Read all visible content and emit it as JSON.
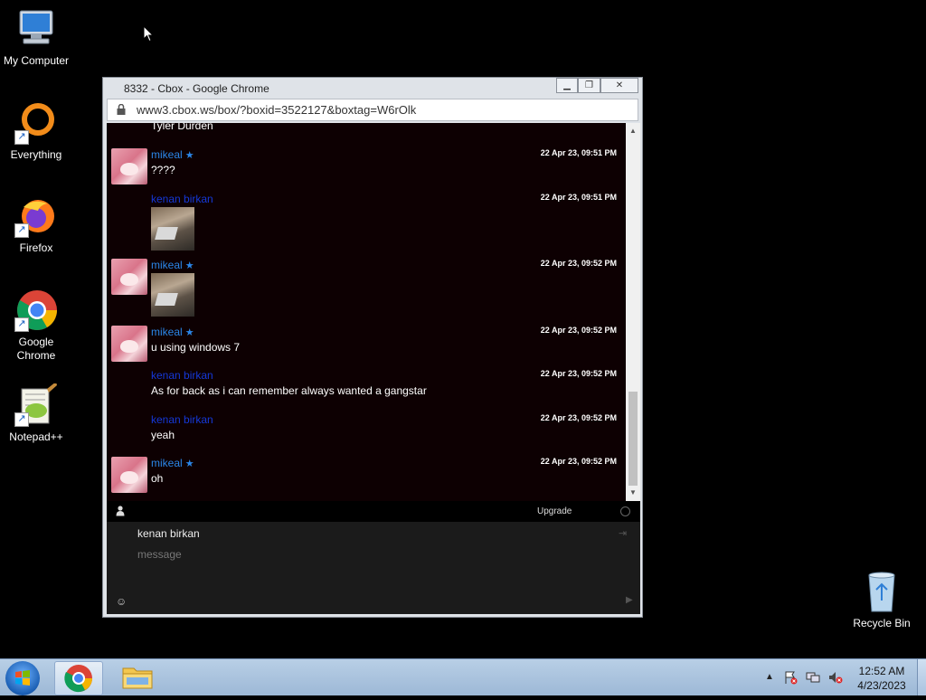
{
  "desktop": {
    "icons": [
      {
        "label": "My Computer"
      },
      {
        "label": "Everything"
      },
      {
        "label": "Firefox"
      },
      {
        "label": "Google Chrome"
      },
      {
        "label": "Notepad++"
      },
      {
        "label": "Recycle Bin"
      }
    ]
  },
  "window": {
    "title": "8332 - Cbox - Google Chrome",
    "url": "www3.cbox.ws/box/?boxid=3522127&boxtag=W6rOlk"
  },
  "chat": {
    "partial_text": "Tyler Durden",
    "messages": [
      {
        "user": "mikeal",
        "time": "22 Apr 23, 09:51 PM",
        "text": "????"
      },
      {
        "user": "kenan birkan",
        "time": "22 Apr 23, 09:51 PM",
        "text": ""
      },
      {
        "user": "mikeal",
        "time": "22 Apr 23, 09:52 PM",
        "text": ""
      },
      {
        "user": "mikeal",
        "time": "22 Apr 23, 09:52 PM",
        "text": "u using windows 7"
      },
      {
        "user": "kenan birkan",
        "time": "22 Apr 23, 09:52 PM",
        "text": "As for back as i can remember always wanted a gangstar"
      },
      {
        "user": "kenan birkan",
        "time": "22 Apr 23, 09:52 PM",
        "text": "yeah"
      },
      {
        "user": "mikeal",
        "time": "22 Apr 23, 09:52 PM",
        "text": "oh"
      }
    ],
    "upgrade_label": "Upgrade",
    "composer": {
      "name": "kenan birkan",
      "placeholder": "message"
    }
  },
  "taskbar": {
    "time": "12:52 AM",
    "date": "4/23/2023"
  },
  "colors": {
    "mikeal": "#2b86e8",
    "kenan": "#1538d8",
    "chat_bg": "#0d0002"
  }
}
